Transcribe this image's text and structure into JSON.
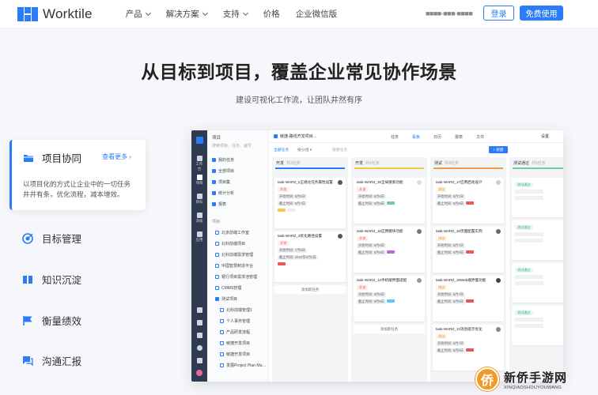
{
  "nav": {
    "brand": "Worktile",
    "menu": [
      {
        "label": "产品",
        "has_dropdown": true
      },
      {
        "label": "解决方案",
        "has_dropdown": true
      },
      {
        "label": "支持",
        "has_dropdown": true
      },
      {
        "label": "价格",
        "has_dropdown": false
      },
      {
        "label": "企业微信版",
        "has_dropdown": false
      }
    ],
    "phone": "■■■■-■■■-■■■■",
    "login_label": "登录",
    "free_label": "免费使用",
    "accent": "#2a7cf7"
  },
  "hero": {
    "title": "从目标到项目，覆盖企业常见协作场景",
    "subtitle": "建设可视化工作流，让团队井然有序"
  },
  "features": {
    "active": {
      "title": "项目协同",
      "more": "查看更多 ›",
      "desc": "以项目化的方式让企业中的一切任务井井有条，优化流程，减本增效。",
      "icon": "folder-icon"
    },
    "items": [
      {
        "label": "目标管理",
        "icon": "target-icon"
      },
      {
        "label": "知识沉淀",
        "icon": "book-icon"
      },
      {
        "label": "衡量绩效",
        "icon": "flag-icon"
      },
      {
        "label": "沟通汇报",
        "icon": "chat-icon"
      }
    ]
  },
  "app": {
    "rail": [
      "工作台",
      "项目",
      "目标",
      "添加",
      "应用"
    ],
    "side": {
      "title": "项目",
      "search_placeholder": "搜索项目、任务、编号",
      "top_items": [
        "我的任务",
        "全部项目",
        "项目集",
        "统计分析",
        "报表"
      ],
      "section": "项目",
      "projects": [
        "北京前端工作室",
        "北科前端项目",
        "北科前端需求管理",
        "中国智慧制造平台",
        "银行项目需求池管理",
        "CMMS管理",
        "测试项目",
        "北科前端管理1",
        "个人事务管理",
        "产品研发流程",
        "敏捷开发项目",
        "敏捷开发项目",
        "发展Project Plan Ma…"
      ]
    },
    "topbar": {
      "project": "敏捷-路线开发项目…",
      "tabs": [
        "任务",
        "看板",
        "日历",
        "报表",
        "文件"
      ],
      "active_tab": "看板",
      "settings": "设置"
    },
    "toolbar": {
      "filter": "全部任务",
      "sort": "按分组 ▾",
      "search_placeholder": "搜索任务",
      "new_label": "+ 新建"
    },
    "columns": [
      {
        "name": "开发",
        "count": "共3任务",
        "color": "#2a7cf7",
        "cards": [
          {
            "title": "task-WARZ_2正规化任务属性设置",
            "status": "开发",
            "start": "开始时间: 8月5日",
            "end": "截止时间: 8月7日",
            "tag": "#f2c94c"
          },
          {
            "title": "task-WARZ_3优化路径设置",
            "status": "开发",
            "start": "开始时间: 7月8日",
            "end": "截止时间: 2020年8月2日",
            "tag": "#f2c94c"
          }
        ],
        "add": "添加新任务"
      },
      {
        "name": "开发",
        "count": "共4任务",
        "color": "#f2c94c",
        "cards": [
          {
            "title": "task-WARZ_15全局搜索功能",
            "status": "开发",
            "start": "开始时间: 8月6日",
            "end": "截止时间: 8月9日",
            "tag": "#6fcf97"
          },
          {
            "title": "task-WARZ_16应用模块功能",
            "status": "开发",
            "start": "开始时间: 8月6日",
            "end": "截止时间: 8月9日",
            "tag": "#bb6bd9"
          },
          {
            "title": "task-WARZ_14手机端界面适配",
            "status": "开发",
            "start": "开始时间: 8月6日",
            "end": "截止时间: 8月9日",
            "tag": "#56ccf2"
          }
        ],
        "add": "添加新任务"
      },
      {
        "name": "测试",
        "count": "共4任务",
        "color": "#f2994a",
        "cards": [
          {
            "title": "task-WARZ_17应用启动设计",
            "status": "测试",
            "start": "开始时间: 8月7日",
            "end": "截止时间: 8月9日",
            "tag": "#eb5757"
          },
          {
            "title": "task-WARZ_18页面配置实例",
            "status": "测试",
            "start": "开始时间: 8月7日",
            "end": "截止时间: 8月9日",
            "tag": "#eb5757"
          },
          {
            "title": "task-WARZ_19Web端界面功能",
            "status": "测试",
            "start": "开始时间: 8月7日",
            "end": "截止时间: 8月9日",
            "tag": "#eb5757"
          },
          {
            "title": "task-WARZ_13消息提示优化",
            "status": "测试",
            "start": "开始时间: 8月7日",
            "end": "截止时间: 8月9日",
            "tag": "#eb5757"
          }
        ],
        "add": "添加新任务"
      },
      {
        "name": "测试通过",
        "count": "共5任务",
        "color": "#6fcf97",
        "cards": [
          {
            "title": "",
            "status": "测试通过",
            "start": "",
            "end": "",
            "tag": ""
          },
          {
            "title": "",
            "status": "测试通过",
            "start": "",
            "end": "",
            "tag": ""
          },
          {
            "title": "",
            "status": "测试通过",
            "start": "",
            "end": "",
            "tag": ""
          },
          {
            "title": "",
            "status": "测试通过",
            "start": "",
            "end": "",
            "tag": ""
          }
        ],
        "add": ""
      }
    ]
  },
  "watermark": {
    "cn": "新侨手游网",
    "en": "XINQIAOSHOUYOUWANG",
    "badge": "侨"
  }
}
